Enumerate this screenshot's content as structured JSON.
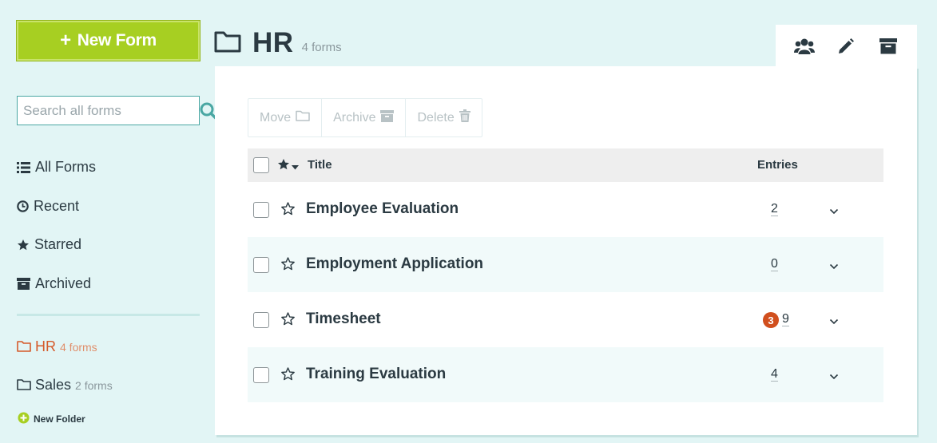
{
  "sidebar": {
    "new_form_label": "New Form",
    "search_placeholder": "Search all forms",
    "nav": [
      {
        "label": "All Forms",
        "icon": "list-icon"
      },
      {
        "label": "Recent",
        "icon": "clock-icon"
      },
      {
        "label": "Starred",
        "icon": "star-icon"
      },
      {
        "label": "Archived",
        "icon": "archive-icon"
      }
    ],
    "folders": [
      {
        "name": "HR",
        "count": "4 forms",
        "active": true
      },
      {
        "name": "Sales",
        "count": "2 forms",
        "active": false
      }
    ],
    "new_folder_label": "New Folder"
  },
  "header": {
    "folder_name": "HR",
    "form_count": "4 forms",
    "actions": [
      "users-icon",
      "pencil-icon",
      "archive-icon"
    ]
  },
  "bulk_actions": {
    "move_label": "Move",
    "archive_label": "Archive",
    "delete_label": "Delete"
  },
  "table": {
    "col_title": "Title",
    "col_entries": "Entries",
    "rows": [
      {
        "title": "Employee Evaluation",
        "entries": "2",
        "badge": ""
      },
      {
        "title": "Employment Application",
        "entries": "0",
        "badge": ""
      },
      {
        "title": "Timesheet",
        "entries": "9",
        "badge": "3"
      },
      {
        "title": "Training Evaluation",
        "entries": "4",
        "badge": ""
      }
    ]
  },
  "colors": {
    "accent_green": "#a7cf22",
    "active_folder": "#d55a2a",
    "badge": "#d14f1e",
    "background": "#e2f5f5"
  }
}
